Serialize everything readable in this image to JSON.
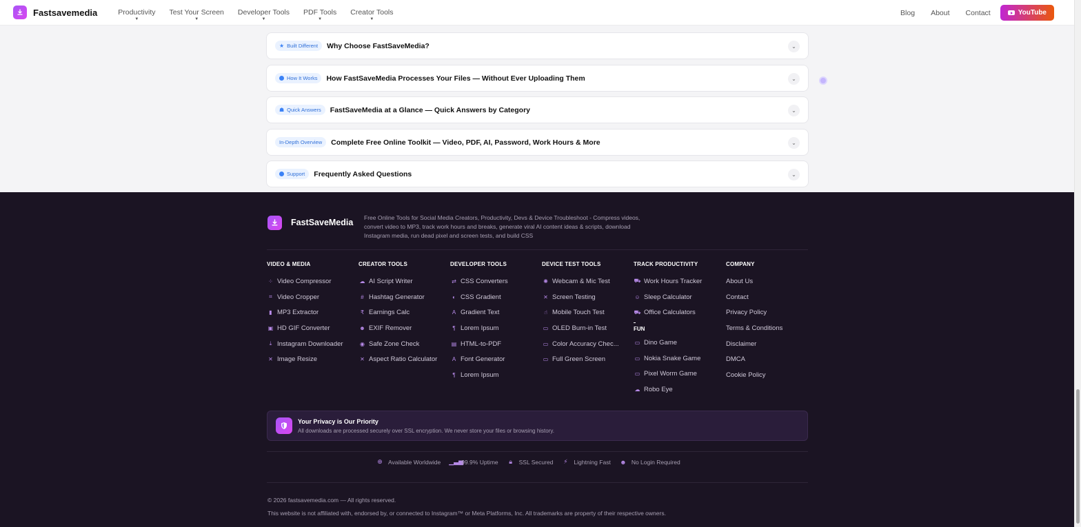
{
  "header": {
    "brand": "Fastsavemedia",
    "nav": [
      {
        "label": "Productivity"
      },
      {
        "label": "Test Your Screen"
      },
      {
        "label": "Developer Tools"
      },
      {
        "label": "PDF Tools"
      },
      {
        "label": "Creator Tools"
      }
    ],
    "right_links": [
      {
        "label": "Blog"
      },
      {
        "label": "About"
      },
      {
        "label": "Contact"
      }
    ],
    "youtube_label": "YouTube"
  },
  "accordions": [
    {
      "pill": "Built Different",
      "title": "Why Choose FastSaveMedia?"
    },
    {
      "pill": "How It Works",
      "title": "How FastSaveMedia Processes Your Files — Without Ever Uploading Them"
    },
    {
      "pill": "Quick Answers",
      "title": "FastSaveMedia at a Glance — Quick Answers by Category"
    },
    {
      "pill": "In-Depth Overview",
      "title": "Complete Free Online Toolkit — Video, PDF, AI, Password, Work Hours & More"
    },
    {
      "pill": "Support",
      "title": "Frequently Asked Questions"
    }
  ],
  "footer": {
    "brand": "FastSaveMedia",
    "description": "Free Online Tools for Social Media Creators, Productivity, Devs & Device Troubleshoot - Compress videos, convert video to MP3, track work hours and breaks, generate viral AI content ideas & scripts, download Instagram media, run dead pixel and screen tests, and build CSS",
    "columns": [
      {
        "heading": "VIDEO & MEDIA",
        "items": [
          {
            "label": "Video Compressor",
            "icon": "⁘"
          },
          {
            "label": "Video Cropper",
            "icon": "⌗"
          },
          {
            "label": "MP3 Extractor",
            "icon": "▮"
          },
          {
            "label": "HD GIF Converter",
            "icon": "▣"
          },
          {
            "label": "Instagram Downloader",
            "icon": "⤓"
          },
          {
            "label": "Image Resize",
            "icon": "✕"
          }
        ]
      },
      {
        "heading": "CREATOR TOOLS",
        "items": [
          {
            "label": "AI Script Writer",
            "icon": "☁"
          },
          {
            "label": "Hashtag Generator",
            "icon": "#"
          },
          {
            "label": "Earnings Calc",
            "icon": "₹"
          },
          {
            "label": "EXIF Remover",
            "icon": "☻"
          },
          {
            "label": "Safe Zone Check",
            "icon": "◉"
          },
          {
            "label": "Aspect Ratio Calculator",
            "icon": "✕"
          }
        ]
      },
      {
        "heading": "DEVELOPER TOOLS",
        "items": [
          {
            "label": "CSS Converters",
            "icon": "⇄"
          },
          {
            "label": "CSS Gradient",
            "icon": "◐"
          },
          {
            "label": "Gradient Text",
            "icon": "A"
          },
          {
            "label": "Lorem Ipsum",
            "icon": "¶"
          },
          {
            "label": "HTML-to-PDF",
            "icon": "▤"
          },
          {
            "label": "Font Generator",
            "icon": "A"
          },
          {
            "label": "Lorem Ipsum",
            "icon": "¶"
          }
        ]
      },
      {
        "heading": "DEVICE TEST TOOLS",
        "items": [
          {
            "label": "Webcam & Mic Test",
            "icon": "✺"
          },
          {
            "label": "Screen Testing",
            "icon": "✕"
          },
          {
            "label": "Mobile Touch Test",
            "icon": "☝"
          },
          {
            "label": "OLED Burn-in Test",
            "icon": "▭"
          },
          {
            "label": "Color Accuracy Chec...",
            "icon": "▭"
          },
          {
            "label": "Full Green Screen",
            "icon": "▭"
          }
        ]
      },
      {
        "heading": "TRACK PRODUCTIVITY",
        "items": [
          {
            "label": "Work Hours Tracker",
            "icon": "⛟"
          },
          {
            "label": "Sleep Calculator",
            "icon": "☺"
          },
          {
            "label": "Office Calculators",
            "icon": "⛟"
          }
        ],
        "fun_heading": "FUN",
        "fun_items": [
          {
            "label": "Dino Game",
            "icon": "▭"
          },
          {
            "label": "Nokia Snake Game",
            "icon": "▭"
          },
          {
            "label": "Pixel Worm Game",
            "icon": "▭"
          },
          {
            "label": "Robo Eye",
            "icon": "☁"
          }
        ]
      },
      {
        "heading": "COMPANY",
        "items": [
          {
            "label": "About Us"
          },
          {
            "label": "Contact"
          },
          {
            "label": "Privacy Policy"
          },
          {
            "label": "Terms & Conditions"
          },
          {
            "label": "Disclaimer"
          },
          {
            "label": "DMCA"
          },
          {
            "label": "Cookie Policy"
          }
        ]
      }
    ],
    "privacy": {
      "title": "Your Privacy is Our Priority",
      "text": "All downloads are processed securely over SSL encryption. We never store your files or browsing history."
    },
    "badges": [
      {
        "label": "Available Worldwide",
        "icon": "globe-icon"
      },
      {
        "label": "99.9% Uptime",
        "icon": "signal-icon"
      },
      {
        "label": "SSL Secured",
        "icon": "lock-icon"
      },
      {
        "label": "Lightning Fast",
        "icon": "bolt-icon"
      },
      {
        "label": "No Login Required",
        "icon": "user-icon"
      }
    ],
    "copyright": "© 2026 fastsavemedia.com — All rights reserved.",
    "disclaimer": "This website is not affiliated with, endorsed by, or connected to Instagram™ or Meta Platforms, Inc. All trademarks are property of their respective owners."
  },
  "colors": {
    "accent": "#a855f7",
    "footer_bg": "#1b1423",
    "pill_bg": "#eaf2ff",
    "pill_text": "#2f6fd8"
  }
}
